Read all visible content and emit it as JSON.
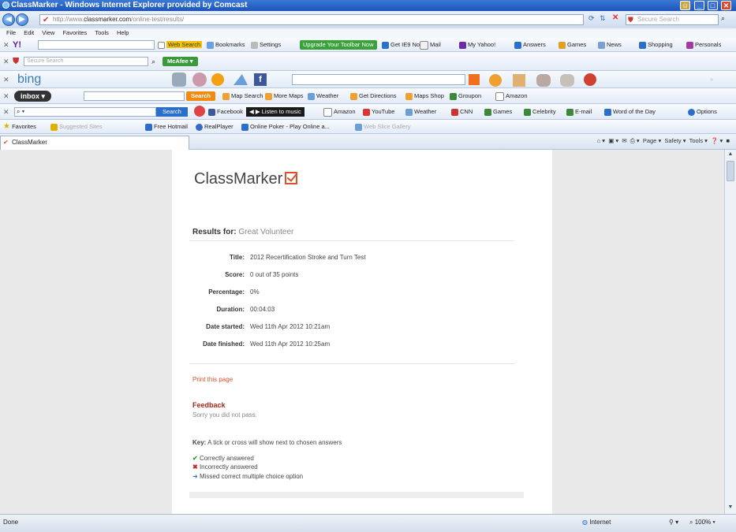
{
  "window": {
    "title": "ClassMarker - Windows Internet Explorer provided by Comcast"
  },
  "address": {
    "prefix": "http://www.",
    "domain": "classmarker.com",
    "path": "/online-test/results/",
    "search_placeholder": "Secure Search"
  },
  "menu": [
    "File",
    "Edit",
    "View",
    "Favorites",
    "Tools",
    "Help"
  ],
  "toolbar_yahoo": {
    "web_search": "Web Search",
    "bookmarks": "Bookmarks",
    "settings": "Settings",
    "upgrade": "Upgrade Your Toolbar Now",
    "get_ie": "Get IE9 Now!",
    "mail": "Mail",
    "my_yahoo": "My Yahoo!",
    "answers": "Answers",
    "games": "Games",
    "news": "News",
    "shopping": "Shopping",
    "personals": "Personals"
  },
  "toolbar_mcafee": {
    "search_placeholder": "Secure Search",
    "mcafee": "McAfee"
  },
  "toolbar_bing": {
    "logo": "bing"
  },
  "toolbar_inbox": {
    "logo": "inbox",
    "search": "Search",
    "map_search": "Map Search",
    "more_maps": "More Maps",
    "weather": "Weather",
    "directions": "Get Directions",
    "maps_shop": "Maps Shop",
    "groupon": "Groupon",
    "amazon": "Amazon"
  },
  "toolbar_search": {
    "search": "Search",
    "facebook": "Facebook",
    "listen": "Listen to music",
    "amazon": "Amazon",
    "youtube": "YouTube",
    "weather": "Weather",
    "cnn": "CNN",
    "games": "Games",
    "celebrity": "Celebrity",
    "email": "E-mail",
    "word": "Word of the Day",
    "options": "Options"
  },
  "favorites": {
    "label": "Favorites",
    "suggested": "Suggested Sites",
    "free_hotmail": "Free Hotmail",
    "realplayer": "RealPlayer",
    "poker": "Online Poker - Play Online a...",
    "web_slice": "Web Slice Gallery"
  },
  "tab": {
    "title": "ClassMarker",
    "page": "Page",
    "safety": "Safety",
    "tools": "Tools"
  },
  "results": {
    "logo": "ClassMarker",
    "results_for_label": "Results for:",
    "results_for_name": "Great Volunteer",
    "fields": [
      {
        "label": "Title:",
        "value": "2012 Recertification Stroke and Turn Test"
      },
      {
        "label": "Score:",
        "value": "0 out of 35 points"
      },
      {
        "label": "Percentage:",
        "value": "0%"
      },
      {
        "label": "Duration:",
        "value": "00:04:03"
      },
      {
        "label": "Date started:",
        "value": "Wed 11th Apr 2012 10:21am"
      },
      {
        "label": "Date finished:",
        "value": "Wed 11th Apr 2012 10:25am"
      }
    ],
    "print": "Print this page",
    "feedback_title": "Feedback",
    "feedback_text": "Sorry you did not pass.",
    "key_label": "Key:",
    "key_text": "A tick or cross will show next to chosen answers",
    "key_items": [
      "Correctly answered",
      "Incorrectly answered",
      "Missed correct multiple choice option"
    ]
  },
  "status": {
    "left": "Done",
    "zone": "Internet",
    "zoom": "100%"
  }
}
